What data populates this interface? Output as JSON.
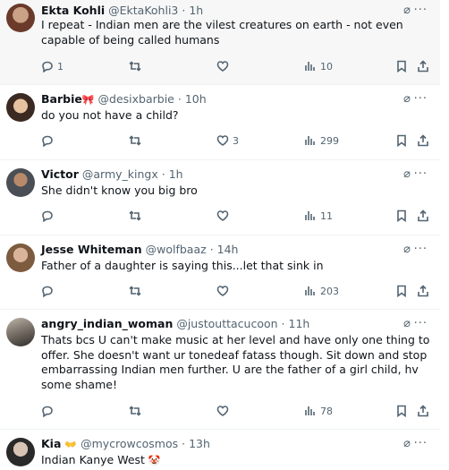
{
  "tweets": [
    {
      "name": "Ekta Kohli",
      "handle": "@EktaKohli3",
      "time": "1h",
      "text": "I repeat - Indian men are the vilest creatures on earth - not even capable of being called humans",
      "replies": "1",
      "retweets": "",
      "likes": "",
      "views": "10"
    },
    {
      "name": "Barbie",
      "name_emoji": "🎀",
      "handle": "@desixbarbie",
      "time": "10h",
      "text": "do you not have a child?",
      "replies": "",
      "retweets": "",
      "likes": "3",
      "views": "299"
    },
    {
      "name": "Victor",
      "handle": "@army_kingx",
      "time": "1h",
      "text": "She didn't know you big bro",
      "replies": "",
      "retweets": "",
      "likes": "",
      "views": "11"
    },
    {
      "name": "Jesse Whiteman",
      "handle": "@wolfbaaz",
      "time": "14h",
      "text": "Father of a daughter is saying this...let that sink in",
      "replies": "",
      "retweets": "",
      "likes": "",
      "views": "203"
    },
    {
      "name": "angry_indian_woman",
      "handle": "@justouttacucoon",
      "time": "11h",
      "text": "Thats bcs U can't make music at her level and have only one thing to offer. She doesn't want ur tonedeaf fatass though. Sit down and stop embarrassing Indian men further. U are the father of a girl child, hv some shame!",
      "replies": "",
      "retweets": "",
      "likes": "",
      "views": "78"
    },
    {
      "name": "Kia",
      "name_emoji": "👐",
      "handle": "@mycrowcosmos",
      "time": "13h",
      "text": "Indian Kanye West",
      "text_emoji": "🤡"
    }
  ],
  "separator": "·",
  "icons": {
    "grok": "grok-slash-icon",
    "more": "more-dots-icon",
    "reply": "reply-icon",
    "retweet": "retweet-icon",
    "like": "heart-icon",
    "views": "views-bar-icon",
    "bookmark": "bookmark-icon",
    "share": "share-icon"
  }
}
